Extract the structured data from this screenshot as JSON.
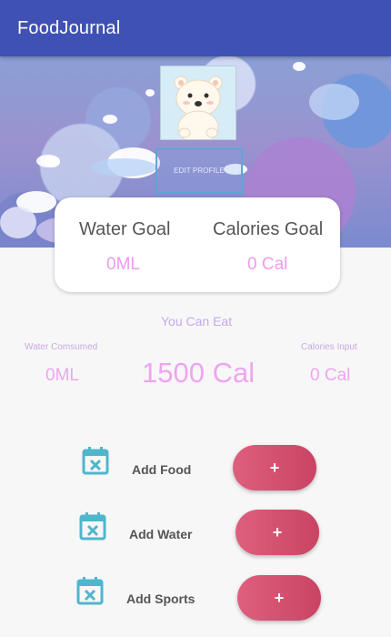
{
  "app": {
    "title": "FoodJournal"
  },
  "profile": {
    "edit_label": "EDIT PROFILE"
  },
  "goals": {
    "water_label": "Water Goal",
    "water_value": "0ML",
    "calories_label": "Calories Goal",
    "calories_value": "0 Cal"
  },
  "summary": {
    "you_can_eat_label": "You Can Eat",
    "water_consumed_label": "Water Comsumed",
    "water_consumed_value": "0ML",
    "calories_remaining_value": "1500 Cal",
    "calories_input_label": "Calories Input",
    "calories_input_value": "0 Cal"
  },
  "actions": [
    {
      "label": "Add Food",
      "button_label": "+",
      "icon": "calendar-x-icon"
    },
    {
      "label": "Add Water",
      "button_label": "+",
      "icon": "calendar-x-icon"
    },
    {
      "label": "Add Sports",
      "button_label": "+",
      "icon": "calendar-x-icon"
    }
  ],
  "colors": {
    "appbar": "#3f51b5",
    "accent_pink": "#ee9aee",
    "button_red": "#d4506e",
    "icon_teal": "#4fb6cc"
  }
}
